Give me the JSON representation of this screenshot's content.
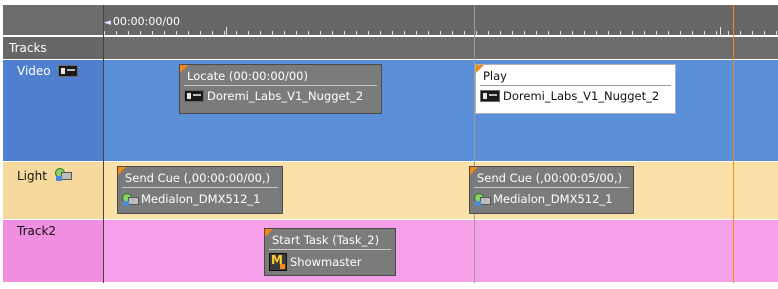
{
  "ruler": {
    "time": "00:00:00/00"
  },
  "tracks_header": "Tracks",
  "lanes": {
    "video": {
      "label": "Video"
    },
    "light": {
      "label": "Light"
    },
    "track2": {
      "label": "Track2"
    }
  },
  "cues": {
    "locate": {
      "title": "Locate (00:00:00/00)",
      "device": "Doremi_Labs_V1_Nugget_2"
    },
    "play": {
      "title": "Play",
      "device": "Doremi_Labs_V1_Nugget_2"
    },
    "send_cue_1": {
      "title": "Send Cue (,00:00:00/00,)",
      "device": "Medialon_DMX512_1"
    },
    "send_cue_2": {
      "title": "Send Cue (,00:00:05/00,)",
      "device": "Medialon_DMX512_1"
    },
    "start_task": {
      "title": "Start Task (Task_2)",
      "device": "Showmaster"
    }
  },
  "icons": {
    "video": "video-device-icon",
    "light": "dmx-light-icon",
    "showmaster": "showmaster-icon"
  },
  "colors": {
    "video_lane": "#5b8fd8",
    "light_lane": "#fbe0a8",
    "track2_lane": "#f6a0ea",
    "playhead": "#f08a1b"
  }
}
